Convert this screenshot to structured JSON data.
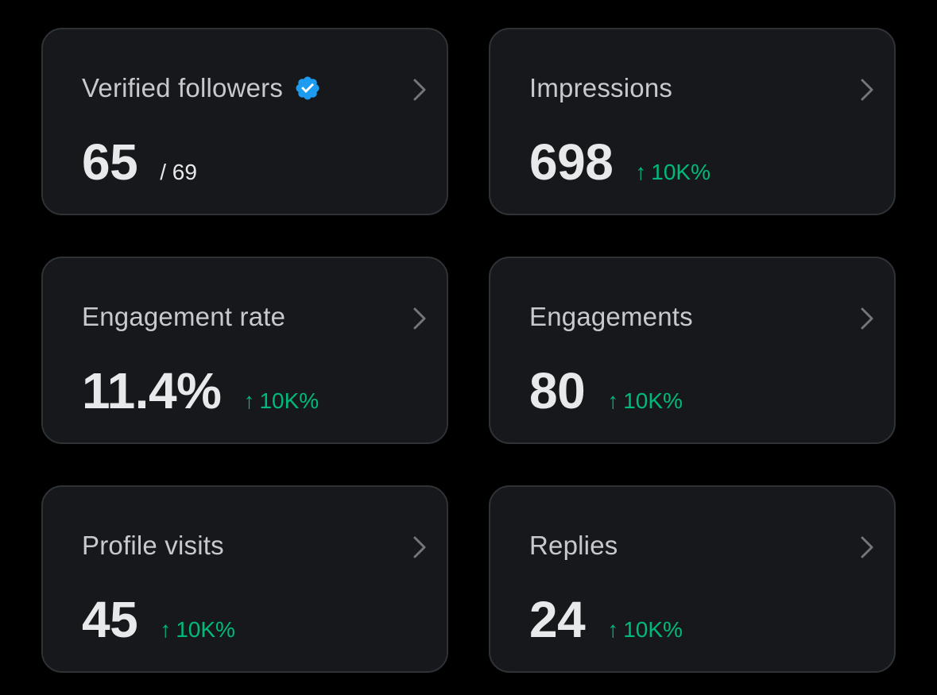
{
  "colors": {
    "background": "#000000",
    "card": "#16181c",
    "border": "#2f3336",
    "label": "#c6c9cd",
    "value": "#e7e9ea",
    "positive": "#00ba7c",
    "verified_badge": "#1d9bf0"
  },
  "cards": [
    {
      "label": "Verified followers",
      "value": "65",
      "total": "/ 69",
      "icon": "verified-badge-icon"
    },
    {
      "label": "Impressions",
      "value": "698",
      "delta_arrow": "↑",
      "delta": "10K%"
    },
    {
      "label": "Engagement rate",
      "value": "11.4%",
      "delta_arrow": "↑",
      "delta": "10K%"
    },
    {
      "label": "Engagements",
      "value": "80",
      "delta_arrow": "↑",
      "delta": "10K%"
    },
    {
      "label": "Profile visits",
      "value": "45",
      "delta_arrow": "↑",
      "delta": "10K%"
    },
    {
      "label": "Replies",
      "value": "24",
      "delta_arrow": "↑",
      "delta": "10K%"
    }
  ]
}
